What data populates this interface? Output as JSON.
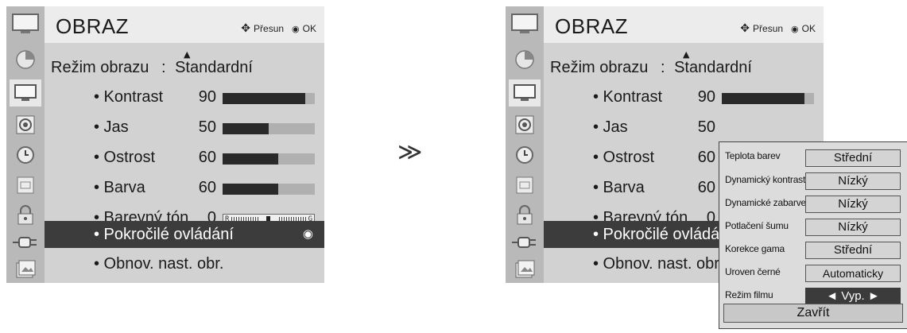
{
  "menu": {
    "title": "OBRAZ",
    "hint_move": "Přesun",
    "hint_ok": "OK",
    "mode_label": "Režim obrazu",
    "mode_sep": ":",
    "mode_value": "Standardní",
    "items": [
      {
        "label": "• Kontrast",
        "value": "90",
        "level": 90
      },
      {
        "label": "• Jas",
        "value": "50",
        "level": 50
      },
      {
        "label": "• Ostrost",
        "value": "60",
        "level": 60
      },
      {
        "label": "• Barva",
        "value": "60",
        "level": 60
      },
      {
        "label": "• Barevný tón",
        "value": "0",
        "tint_left": "R",
        "tint_right": "G"
      },
      {
        "label": "• Pokročilé ovládání"
      },
      {
        "label": "• Obnov. nast. obr."
      }
    ],
    "right_highlight_label": "• Pokročilé ovládá",
    "right_reset_label": "• Obnov. nast. obr"
  },
  "sidebar_icons": [
    "tv-monitor-icon",
    "picture-icon",
    "tv-icon",
    "audio-icon",
    "clock-icon",
    "option-icon",
    "lock-icon",
    "input-icon",
    "usb-photo-icon"
  ],
  "arrow": "≫",
  "advanced": {
    "rows": [
      {
        "label": "Teplota barev",
        "value": "Střední"
      },
      {
        "label": "Dynamický kontrast",
        "value": "Nízký"
      },
      {
        "label": "Dynamické zabarvení",
        "value": "Nízký"
      },
      {
        "label": "Potlačení šumu",
        "value": "Nízký"
      },
      {
        "label": "Korekce gama",
        "value": "Střední"
      },
      {
        "label": "Uroven černé",
        "value": "Automaticky"
      },
      {
        "label": "Režim filmu",
        "value": "◄ Vyp. ►"
      }
    ],
    "close_label": "Zavřít"
  },
  "colors": {
    "highlight": "#3c3c3c",
    "bar_fill": "#2a2a2a",
    "bar_track": "#b0b0b0",
    "panel": "#d2d2d2"
  }
}
